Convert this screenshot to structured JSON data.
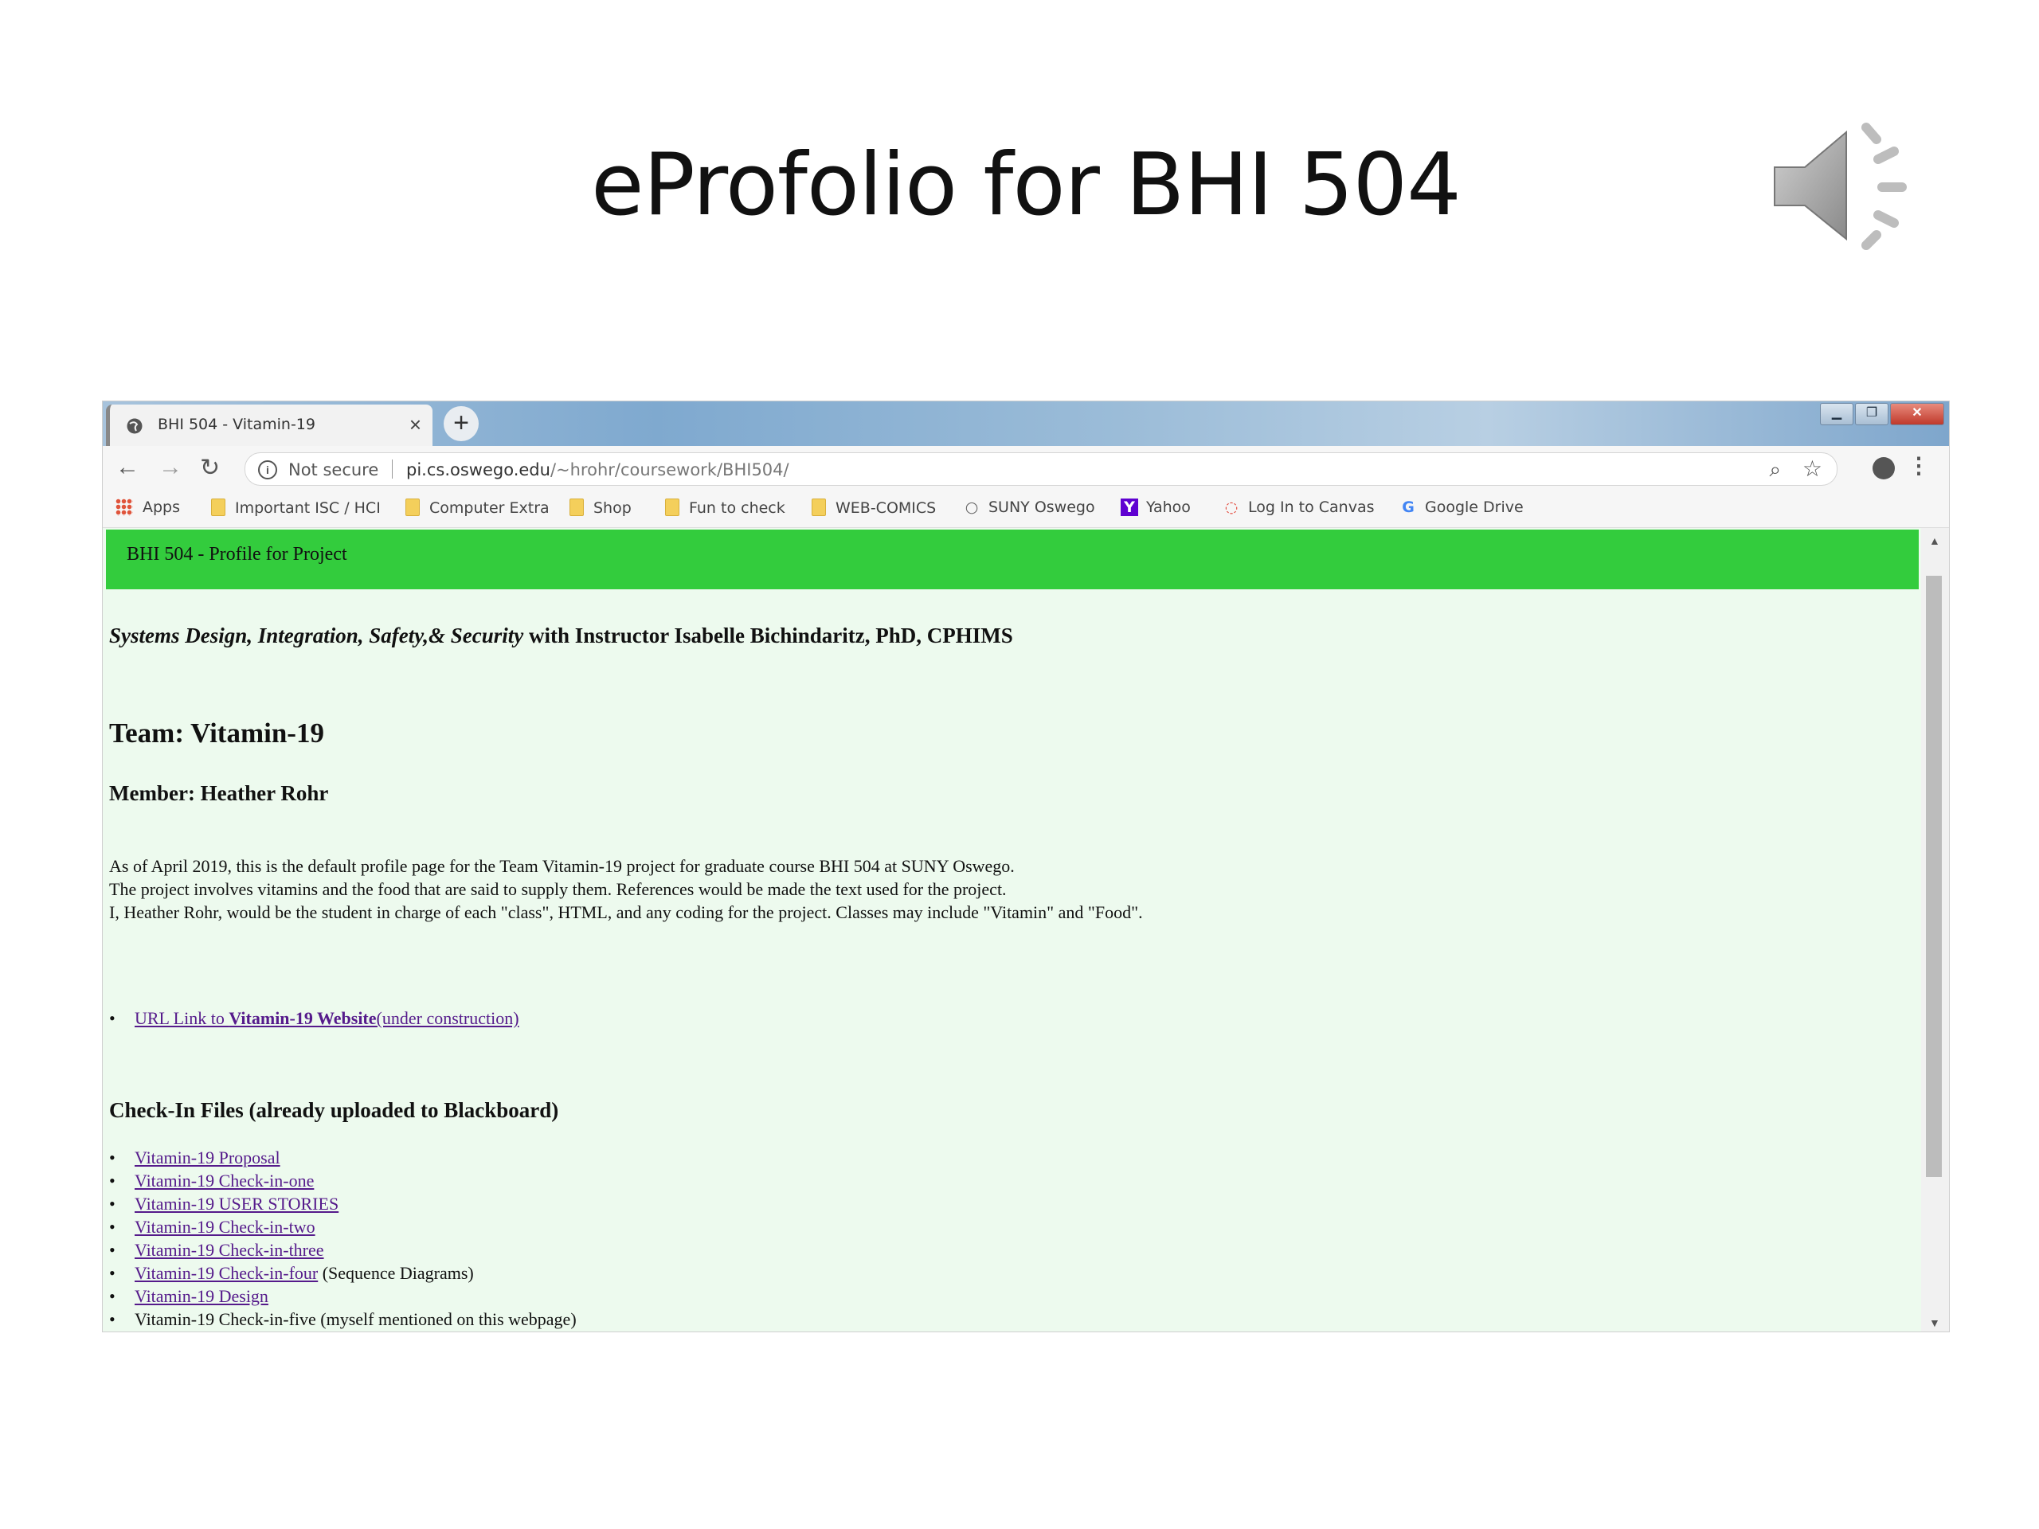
{
  "slide": {
    "title": "eProfolio for BHI 504"
  },
  "browser": {
    "tab_title": "BHI 504 - Vitamin-19",
    "tab_close": "×",
    "new_tab": "+",
    "nav": {
      "back": "←",
      "forward": "→",
      "reload": "↻"
    },
    "security_label": "Not secure",
    "url_host": "pi.cs.oswego.edu",
    "url_path": "/~hrohr/coursework/BHI504/",
    "bookmarks": [
      {
        "label": "Apps"
      },
      {
        "label": "Important ISC / HCI"
      },
      {
        "label": "Computer Extra"
      },
      {
        "label": "Shop"
      },
      {
        "label": "Fun to check"
      },
      {
        "label": "WEB-COMICS"
      },
      {
        "label": "SUNY Oswego"
      },
      {
        "label": "Yahoo"
      },
      {
        "label": "Log In to Canvas"
      },
      {
        "label": "Google Drive"
      }
    ]
  },
  "page": {
    "header": "BHI 504 - Profile for Project",
    "course_italic": "Systems Design, Integration, Safety,& Security",
    "course_rest": " with Instructor Isabelle Bichindaritz, PhD, CPHIMS",
    "team": "Team: Vitamin-19",
    "member": "Member: Heather Rohr",
    "paragraph": [
      "As of April 2019, this is the default profile page for the Team Vitamin-19 project for graduate course BHI 504 at SUNY Oswego.",
      "The project involves vitamins and the food that are said to supply them. References would be made the text used for the project.",
      "I, Heather Rohr, would be the student in charge of each \"class\", HTML, and any coding for the project. Classes may include \"Vitamin\" and \"Food\"."
    ],
    "website_link": {
      "prefix": "URL Link to ",
      "bold": "Vitamin-19 Website",
      "suffix": "(under construction)"
    },
    "checkin_heading": "Check-In Files (already uploaded to Blackboard)",
    "files": [
      {
        "link": "Vitamin-19 Proposal",
        "note": ""
      },
      {
        "link": "Vitamin-19 Check-in-one",
        "note": ""
      },
      {
        "link": "Vitamin-19 USER STORIES",
        "note": ""
      },
      {
        "link": "Vitamin-19 Check-in-two",
        "note": ""
      },
      {
        "link": "Vitamin-19 Check-in-three",
        "note": ""
      },
      {
        "link": "Vitamin-19 Check-in-four",
        "note": " (Sequence Diagrams)"
      },
      {
        "link": "Vitamin-19 Design",
        "note": ""
      }
    ],
    "last_item": "Vitamin-19 Check-in-five (myself mentioned on this webpage)"
  }
}
